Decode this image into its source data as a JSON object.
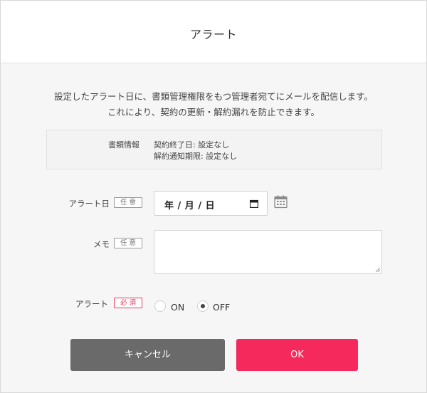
{
  "dialog": {
    "title": "アラート",
    "description_line1": "設定したアラート日に、書類管理権限をもつ管理者宛てにメールを配信します。",
    "description_line2": "これにより、契約の更新・解約漏れを防止できます。"
  },
  "info": {
    "label": "書類情報",
    "line1": "契約終了日: 設定なし",
    "line2": "解約通知期限: 設定なし"
  },
  "form": {
    "alert_date": {
      "label": "アラート日",
      "badge": "任 意",
      "value": "年 / 月 / 日"
    },
    "memo": {
      "label": "メモ",
      "badge": "任 意",
      "value": ""
    },
    "alert": {
      "label": "アラート",
      "badge": "必 須",
      "options": [
        "ON",
        "OFF"
      ],
      "selected": "OFF"
    }
  },
  "buttons": {
    "cancel": "キャンセル",
    "ok": "OK"
  },
  "colors": {
    "primary": "#f5295b",
    "secondary": "#6a6a6a",
    "required": "#e8385f"
  }
}
